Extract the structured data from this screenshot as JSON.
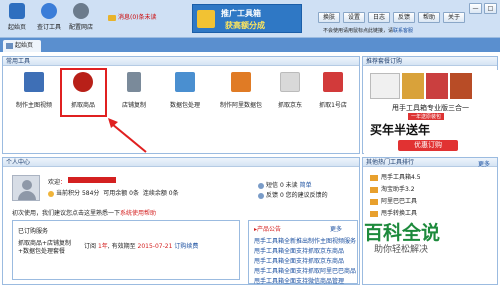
{
  "toolbar": {
    "items": [
      {
        "label": "起始页",
        "icon": "home-icon",
        "color": "#2f6fbf"
      },
      {
        "label": "查订工具",
        "icon": "search-tool-icon",
        "color": "#3b7dd8"
      },
      {
        "label": "配置网店",
        "icon": "gear-icon",
        "color": "#6b7b8c"
      }
    ],
    "messages": "消息(0)条未读",
    "banner": {
      "line1": "推广工具箱",
      "line2": "获高额分成"
    },
    "buttons": [
      "换肤",
      "设置",
      "日志",
      "反馈",
      "帮助",
      "关于"
    ],
    "window_buttons": [
      "—",
      "□"
    ],
    "notice_prefix": "不会使用请用鼠标点此链接，请",
    "notice_link": "联系客服"
  },
  "tabs": [
    {
      "label": "起始页",
      "icon": "home-icon"
    }
  ],
  "common_tools": {
    "title": "常用工具",
    "items": [
      {
        "label": "制作主图视频",
        "icon": "video-icon",
        "color": "#3e6fb6"
      },
      {
        "label": "抓取商品",
        "icon": "grab-goods-icon",
        "color": "#b82018"
      },
      {
        "label": "店铺复制",
        "icon": "copy-shop-icon",
        "color": "#7a8a9a"
      },
      {
        "label": "数据包处理",
        "icon": "data-package-icon",
        "color": "#4a8fd0"
      },
      {
        "label": "制作阿里数据包",
        "icon": "ali-package-icon",
        "color": "#e07b25"
      },
      {
        "label": "抓取京东",
        "icon": "jd-icon",
        "color": "#d9d9d9"
      },
      {
        "label": "抓取1号店",
        "icon": "yhd-icon",
        "color": "#d23a3a"
      }
    ]
  },
  "recommend": {
    "title": "推荐套餐订购",
    "ad_line1": "甩手工具箱专业版三合一",
    "ad_line2": "一年送原装包",
    "ad_line3": "买年半送年",
    "ad_button": "优惠订购"
  },
  "personal": {
    "title": "个人中心",
    "welcome": "欢迎",
    "points_label": "当前积分",
    "points_value": "584分",
    "balance_label": "可用余额",
    "balance_value": "0条",
    "consecutive_label": "连续余额",
    "consecutive_value": "0条",
    "mail_label": "短信",
    "mail_count": "0 未读",
    "mail_link": "简单",
    "feedback_label": "反馈",
    "feedback_text": "0 您的建议反馈的",
    "first_use": "初次使用，我们建议您点击这里熟悉一下",
    "first_use_link": "系统使用帮助"
  },
  "subscribed": {
    "title": "已订购服务",
    "service": "抓取商品+店铺复制+数据包处理套餐",
    "order_label": "订阅",
    "order_years": "1年",
    "expire_label": "有效期至",
    "expire_date": "2015-07-21",
    "renew_link": "订购续费"
  },
  "announcements": {
    "title": "产品公告",
    "more": "更多",
    "items": [
      "甩手工具箱全新推出制作主图视频服务",
      "甩手工具箱全面支持抓取京东商品",
      "甩手工具箱全面支持抓取京东商品",
      "甩手工具箱全面支持抓取阿里巴巴商品",
      "甩手工具箱全面支持微信商品管理"
    ]
  },
  "ranking": {
    "title": "其他热门工具排行",
    "more": "更多",
    "items": [
      {
        "name": "甩手工具箱4.5"
      },
      {
        "name": "淘宝助手3.2"
      },
      {
        "name": "阿里巴巴工具"
      },
      {
        "name": "甩手转换工具"
      }
    ]
  },
  "watermark": {
    "line1": "百科全说",
    "line2": "助你轻松解决"
  }
}
